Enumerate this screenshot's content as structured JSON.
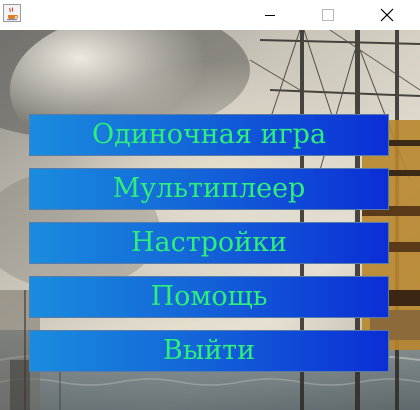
{
  "window": {
    "title": "",
    "icon": "java-coffee-icon",
    "controls": [
      "minimize-icon",
      "maximize-icon",
      "close-icon"
    ]
  },
  "background": {
    "description_icon": "sailing-ship-painting"
  },
  "menu": {
    "items": [
      {
        "label": "Одиночная игра"
      },
      {
        "label": "Мультиплеер"
      },
      {
        "label": "Настройки"
      },
      {
        "label": "Помощь"
      },
      {
        "label": "Выйти"
      }
    ],
    "text_color": "#2cf07a",
    "button_gradient_start": "#1a8cde",
    "button_gradient_end": "#0b2ed6"
  }
}
